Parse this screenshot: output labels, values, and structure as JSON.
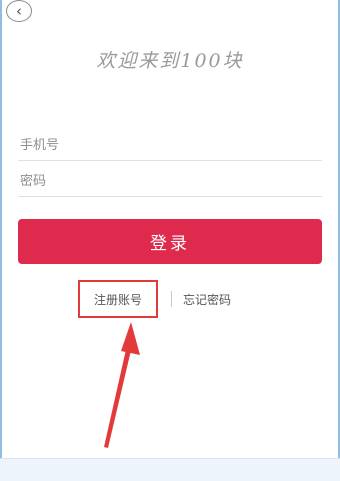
{
  "header": {
    "back_icon": "chevron-left-icon",
    "back_glyph": "‹"
  },
  "welcome_text": "欢迎来到100块",
  "form": {
    "phone_placeholder": "手机号",
    "password_placeholder": "密码",
    "login_label": "登录"
  },
  "links": {
    "register_label": "注册账号",
    "forgot_label": "忘记密码"
  },
  "colors": {
    "primary": "#de2a4d",
    "annotation": "#e23a3a",
    "frame": "#8fbde3"
  }
}
